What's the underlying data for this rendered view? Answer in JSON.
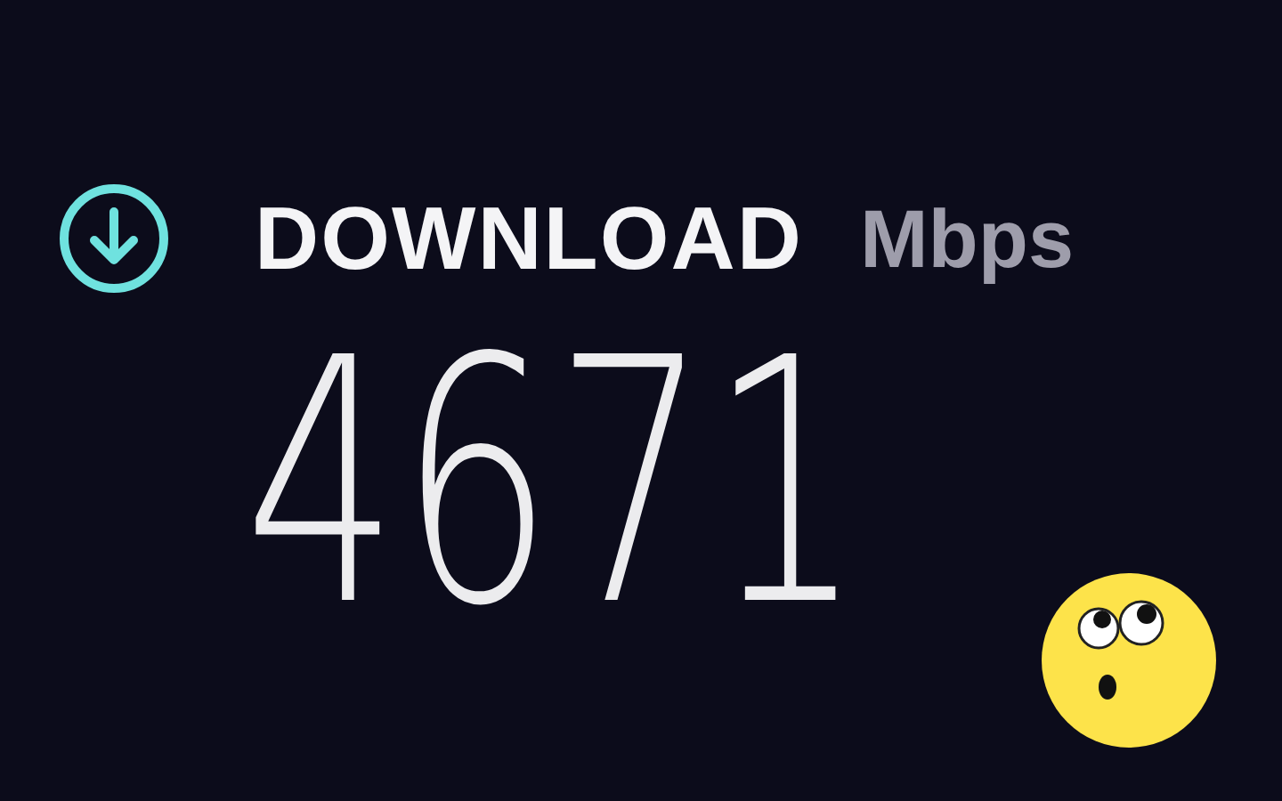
{
  "result": {
    "label": "DOWNLOAD",
    "unit": "Mbps",
    "value": "4671"
  }
}
